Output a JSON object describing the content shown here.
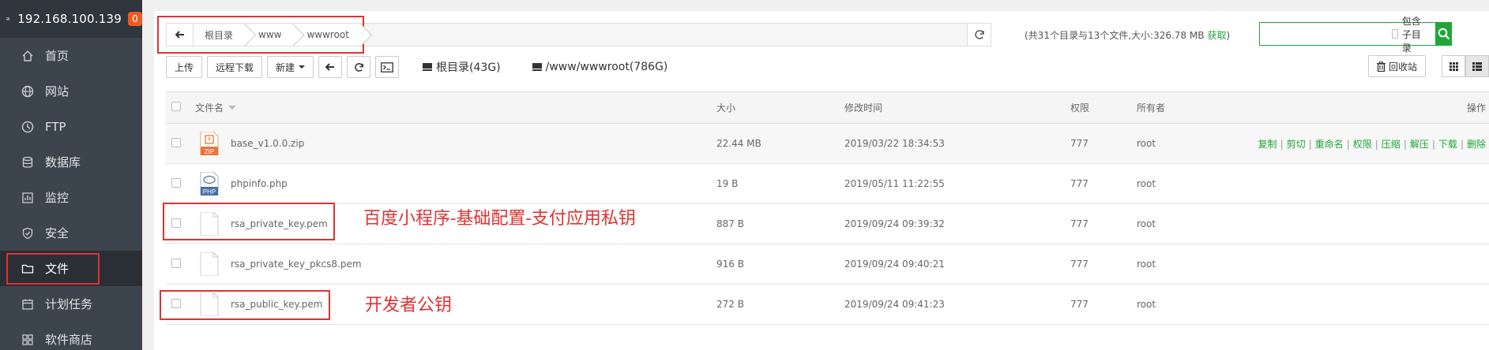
{
  "server": {
    "ip": "192.168.100.139",
    "badge": "0"
  },
  "sidebar": {
    "items": [
      {
        "label": "首页",
        "icon": "home-icon"
      },
      {
        "label": "网站",
        "icon": "globe-icon"
      },
      {
        "label": "FTP",
        "icon": "ftp-icon"
      },
      {
        "label": "数据库",
        "icon": "database-icon"
      },
      {
        "label": "监控",
        "icon": "monitor-icon"
      },
      {
        "label": "安全",
        "icon": "shield-icon"
      },
      {
        "label": "文件",
        "icon": "folder-icon",
        "active": true
      },
      {
        "label": "计划任务",
        "icon": "task-icon"
      },
      {
        "label": "软件商店",
        "icon": "store-icon"
      }
    ]
  },
  "path": {
    "crumbs": [
      "根目录",
      "www",
      "wwwroot"
    ]
  },
  "summary": {
    "text": "(共31个目录与13个文件,大小:326.78 MB",
    "link": "获取",
    "close": ")"
  },
  "search": {
    "placeholder": "",
    "include_sub": "包含子目录"
  },
  "toolbar": {
    "upload": "上传",
    "remote_download": "远程下载",
    "new": "新建",
    "disk_root": "根目录(43G)",
    "disk_www": "/www/wwwroot(786G)",
    "recycle": "回收站"
  },
  "table": {
    "headers": {
      "name": "文件名",
      "size": "大小",
      "time": "修改时间",
      "perm": "权限",
      "owner": "所有者",
      "ops": "操作"
    },
    "rows": [
      {
        "name": "base_v1.0.0.zip",
        "size": "22.44 MB",
        "time": "2019/03/22 18:34:53",
        "perm": "777",
        "owner": "root",
        "icon": "zip"
      },
      {
        "name": "phpinfo.php",
        "size": "19 B",
        "time": "2019/05/11 11:22:55",
        "perm": "777",
        "owner": "root",
        "icon": "php"
      },
      {
        "name": "rsa_private_key.pem",
        "size": "887 B",
        "time": "2019/09/24 09:39:32",
        "perm": "777",
        "owner": "root",
        "icon": "file"
      },
      {
        "name": "rsa_private_key_pkcs8.pem",
        "size": "916 B",
        "time": "2019/09/24 09:40:21",
        "perm": "777",
        "owner": "root",
        "icon": "file"
      },
      {
        "name": "rsa_public_key.pem",
        "size": "272 B",
        "time": "2019/09/24 09:41:23",
        "perm": "777",
        "owner": "root",
        "icon": "file"
      }
    ],
    "ops": [
      "复制",
      "剪切",
      "重命名",
      "权限",
      "压缩",
      "解压",
      "下载",
      "删除"
    ]
  },
  "annotations": {
    "private_key": "百度小程序-基础配置-支付应用私钥",
    "public_key": "开发者公钥"
  },
  "colors": {
    "accent": "#20a53a",
    "highlight": "#e03131",
    "sidebar": "#3c444d"
  }
}
